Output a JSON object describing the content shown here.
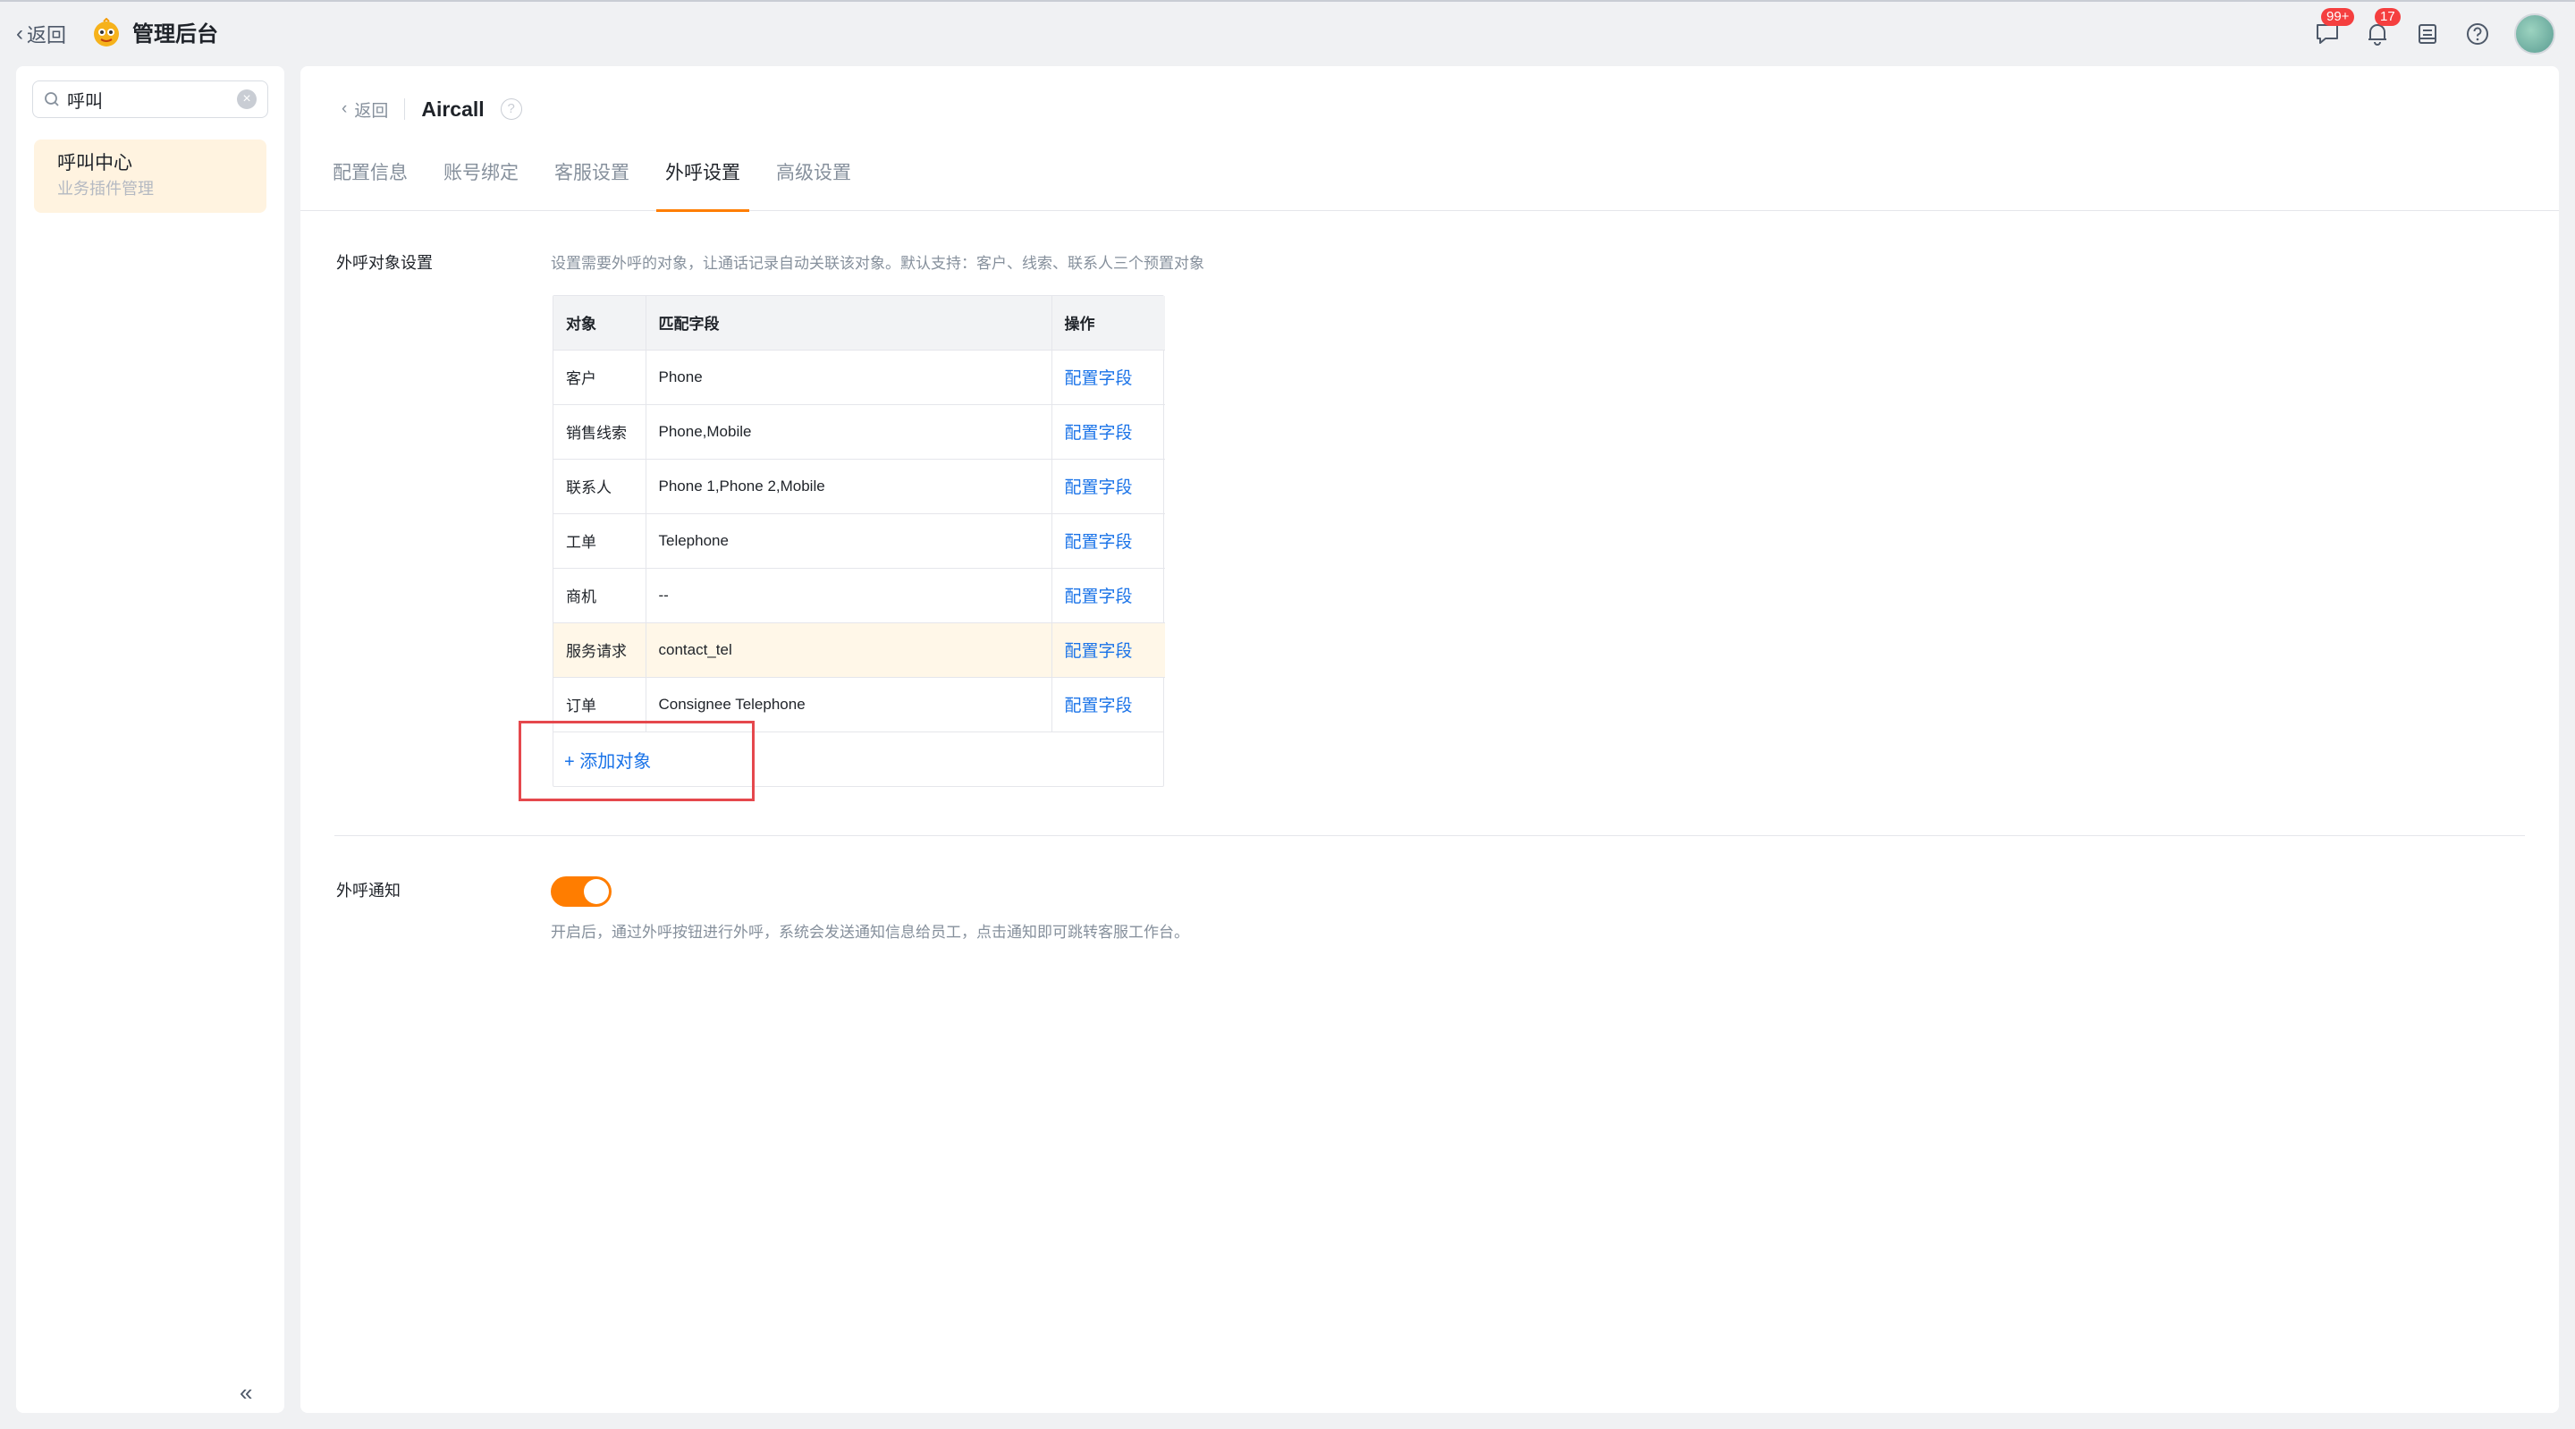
{
  "topbar": {
    "back_label": "返回",
    "app_title": "管理后台",
    "message_badge": "99+",
    "notification_badge": "17"
  },
  "sidebar": {
    "search_value": "呼叫",
    "items": [
      {
        "title": "呼叫中心",
        "subtitle": "业务插件管理"
      }
    ]
  },
  "main": {
    "back_label": "返回",
    "title": "Aircall",
    "tabs": [
      {
        "label": "配置信息"
      },
      {
        "label": "账号绑定"
      },
      {
        "label": "客服设置"
      },
      {
        "label": "外呼设置"
      },
      {
        "label": "高级设置"
      }
    ],
    "active_tab": "外呼设置",
    "outbound_objects": {
      "label": "外呼对象设置",
      "description": "设置需要外呼的对象，让通话记录自动关联该对象。默认支持：客户、线索、联系人三个预置对象",
      "columns": [
        "对象",
        "匹配字段",
        "操作"
      ],
      "rows": [
        {
          "object": "客户",
          "field": "Phone",
          "action": "配置字段"
        },
        {
          "object": "销售线索",
          "field": "Phone,Mobile",
          "action": "配置字段"
        },
        {
          "object": "联系人",
          "field": "Phone 1,Phone 2,Mobile",
          "action": "配置字段"
        },
        {
          "object": "工单",
          "field": "Telephone",
          "action": "配置字段"
        },
        {
          "object": "商机",
          "field": "--",
          "action": "配置字段"
        },
        {
          "object": "服务请求",
          "field": "contact_tel",
          "action": "配置字段"
        },
        {
          "object": "订单",
          "field": "Consignee Telephone",
          "action": "配置字段"
        }
      ],
      "add_label": "+ 添加对象"
    },
    "outbound_notify": {
      "label": "外呼通知",
      "enabled": true,
      "description": "开启后，通过外呼按钮进行外呼，系统会发送通知信息给员工，点击通知即可跳转客服工作台。"
    }
  },
  "colors": {
    "accent": "#ff7d00",
    "link": "#1a73e8",
    "highlight_box": "#e5484d",
    "badge": "#f53f3f"
  }
}
